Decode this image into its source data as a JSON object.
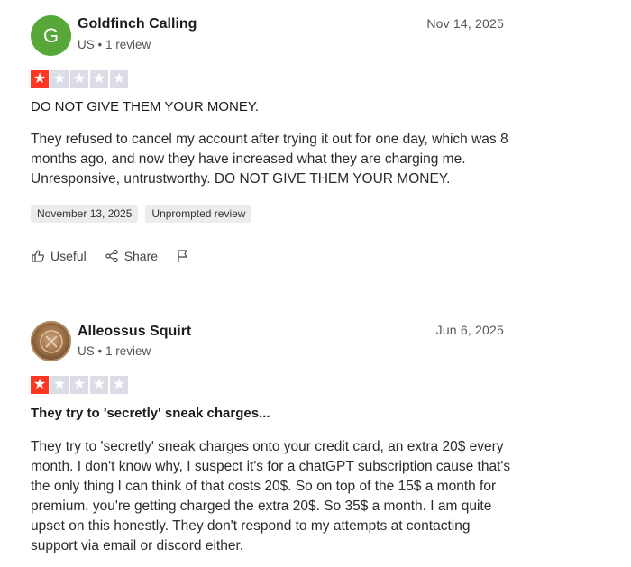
{
  "reviews": [
    {
      "avatar_letter": "G",
      "name": "Goldfinch Calling",
      "meta": "US • 1 review",
      "date": "Nov 14, 2025",
      "rating": 1,
      "title": "DO NOT GIVE THEM YOUR MONEY.",
      "body": "They refused to cancel my account after trying it out for one day, which was 8 months ago, and now they have increased what they are charging me. Unresponsive, untrustworthy. DO NOT GIVE THEM YOUR MONEY.",
      "tags": [
        "November 13, 2025",
        "Unprompted review"
      ],
      "actions": {
        "useful": "Useful",
        "share": "Share"
      }
    },
    {
      "name": "Alleossus Squirt",
      "meta": "US • 1 review",
      "date": "Jun 6, 2025",
      "rating": 1,
      "title": "They try to 'secretly' sneak charges...",
      "body": "They try to 'secretly' sneak charges onto your credit card, an extra 20$ every month. I don't know why, I suspect it's for a chatGPT subscription cause that's the only thing I can think of that costs 20$. So on top of the 15$ a month for premium, you're getting charged the extra 20$. So 35$ a month. I am quite upset on this honestly. They don't respond to my attempts at contacting support via email or discord either."
    }
  ],
  "colors": {
    "star_on": "#ff3722",
    "star_off": "#dcdce6",
    "avatar_green": "#58a839"
  }
}
